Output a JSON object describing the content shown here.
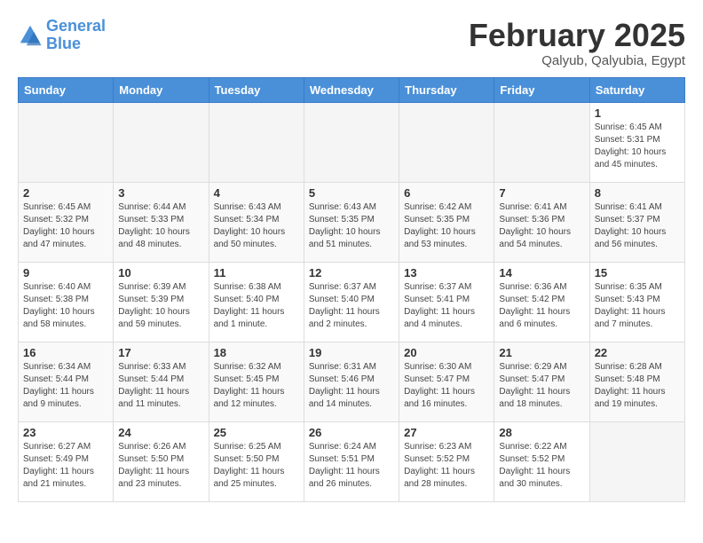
{
  "header": {
    "logo_line1": "General",
    "logo_line2": "Blue",
    "month": "February 2025",
    "location": "Qalyub, Qalyubia, Egypt"
  },
  "days_of_week": [
    "Sunday",
    "Monday",
    "Tuesday",
    "Wednesday",
    "Thursday",
    "Friday",
    "Saturday"
  ],
  "weeks": [
    [
      {
        "day": "",
        "info": ""
      },
      {
        "day": "",
        "info": ""
      },
      {
        "day": "",
        "info": ""
      },
      {
        "day": "",
        "info": ""
      },
      {
        "day": "",
        "info": ""
      },
      {
        "day": "",
        "info": ""
      },
      {
        "day": "1",
        "info": "Sunrise: 6:45 AM\nSunset: 5:31 PM\nDaylight: 10 hours and 45 minutes."
      }
    ],
    [
      {
        "day": "2",
        "info": "Sunrise: 6:45 AM\nSunset: 5:32 PM\nDaylight: 10 hours and 47 minutes."
      },
      {
        "day": "3",
        "info": "Sunrise: 6:44 AM\nSunset: 5:33 PM\nDaylight: 10 hours and 48 minutes."
      },
      {
        "day": "4",
        "info": "Sunrise: 6:43 AM\nSunset: 5:34 PM\nDaylight: 10 hours and 50 minutes."
      },
      {
        "day": "5",
        "info": "Sunrise: 6:43 AM\nSunset: 5:35 PM\nDaylight: 10 hours and 51 minutes."
      },
      {
        "day": "6",
        "info": "Sunrise: 6:42 AM\nSunset: 5:35 PM\nDaylight: 10 hours and 53 minutes."
      },
      {
        "day": "7",
        "info": "Sunrise: 6:41 AM\nSunset: 5:36 PM\nDaylight: 10 hours and 54 minutes."
      },
      {
        "day": "8",
        "info": "Sunrise: 6:41 AM\nSunset: 5:37 PM\nDaylight: 10 hours and 56 minutes."
      }
    ],
    [
      {
        "day": "9",
        "info": "Sunrise: 6:40 AM\nSunset: 5:38 PM\nDaylight: 10 hours and 58 minutes."
      },
      {
        "day": "10",
        "info": "Sunrise: 6:39 AM\nSunset: 5:39 PM\nDaylight: 10 hours and 59 minutes."
      },
      {
        "day": "11",
        "info": "Sunrise: 6:38 AM\nSunset: 5:40 PM\nDaylight: 11 hours and 1 minute."
      },
      {
        "day": "12",
        "info": "Sunrise: 6:37 AM\nSunset: 5:40 PM\nDaylight: 11 hours and 2 minutes."
      },
      {
        "day": "13",
        "info": "Sunrise: 6:37 AM\nSunset: 5:41 PM\nDaylight: 11 hours and 4 minutes."
      },
      {
        "day": "14",
        "info": "Sunrise: 6:36 AM\nSunset: 5:42 PM\nDaylight: 11 hours and 6 minutes."
      },
      {
        "day": "15",
        "info": "Sunrise: 6:35 AM\nSunset: 5:43 PM\nDaylight: 11 hours and 7 minutes."
      }
    ],
    [
      {
        "day": "16",
        "info": "Sunrise: 6:34 AM\nSunset: 5:44 PM\nDaylight: 11 hours and 9 minutes."
      },
      {
        "day": "17",
        "info": "Sunrise: 6:33 AM\nSunset: 5:44 PM\nDaylight: 11 hours and 11 minutes."
      },
      {
        "day": "18",
        "info": "Sunrise: 6:32 AM\nSunset: 5:45 PM\nDaylight: 11 hours and 12 minutes."
      },
      {
        "day": "19",
        "info": "Sunrise: 6:31 AM\nSunset: 5:46 PM\nDaylight: 11 hours and 14 minutes."
      },
      {
        "day": "20",
        "info": "Sunrise: 6:30 AM\nSunset: 5:47 PM\nDaylight: 11 hours and 16 minutes."
      },
      {
        "day": "21",
        "info": "Sunrise: 6:29 AM\nSunset: 5:47 PM\nDaylight: 11 hours and 18 minutes."
      },
      {
        "day": "22",
        "info": "Sunrise: 6:28 AM\nSunset: 5:48 PM\nDaylight: 11 hours and 19 minutes."
      }
    ],
    [
      {
        "day": "23",
        "info": "Sunrise: 6:27 AM\nSunset: 5:49 PM\nDaylight: 11 hours and 21 minutes."
      },
      {
        "day": "24",
        "info": "Sunrise: 6:26 AM\nSunset: 5:50 PM\nDaylight: 11 hours and 23 minutes."
      },
      {
        "day": "25",
        "info": "Sunrise: 6:25 AM\nSunset: 5:50 PM\nDaylight: 11 hours and 25 minutes."
      },
      {
        "day": "26",
        "info": "Sunrise: 6:24 AM\nSunset: 5:51 PM\nDaylight: 11 hours and 26 minutes."
      },
      {
        "day": "27",
        "info": "Sunrise: 6:23 AM\nSunset: 5:52 PM\nDaylight: 11 hours and 28 minutes."
      },
      {
        "day": "28",
        "info": "Sunrise: 6:22 AM\nSunset: 5:52 PM\nDaylight: 11 hours and 30 minutes."
      },
      {
        "day": "",
        "info": ""
      }
    ]
  ]
}
